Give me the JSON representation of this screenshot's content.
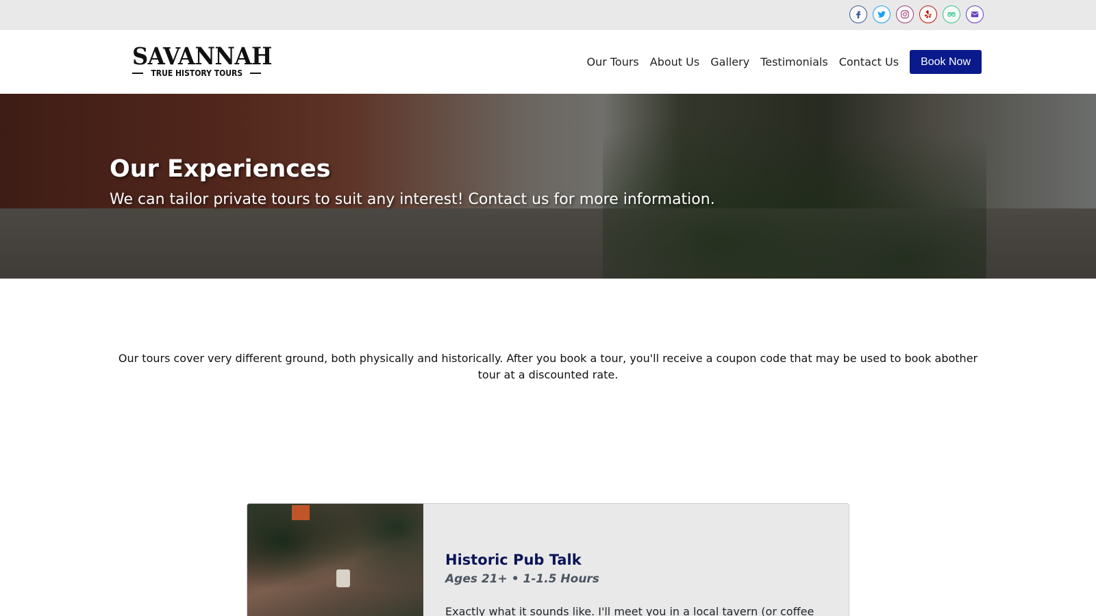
{
  "social": [
    {
      "name": "facebook-icon",
      "color": "#3b5998"
    },
    {
      "name": "twitter-icon",
      "color": "#1da1f2"
    },
    {
      "name": "instagram-icon",
      "color": "#a23f7a"
    },
    {
      "name": "yelp-icon",
      "color": "#c41200"
    },
    {
      "name": "tripadvisor-icon",
      "color": "#34c48a"
    },
    {
      "name": "email-icon",
      "color": "#6a3fc4"
    }
  ],
  "logo": {
    "main": "SAVANNAH",
    "sub": "TRUE HISTORY TOURS"
  },
  "nav": {
    "items": [
      "Our Tours",
      "About Us",
      "Gallery",
      "Testimonials",
      "Contact Us"
    ],
    "book_label": "Book Now",
    "book_color": "#0a1a8c"
  },
  "hero": {
    "title": "Our Experiences",
    "subtitle": "We can tailor private tours to suit any interest! Contact us for more information."
  },
  "intro": {
    "text": "Our tours cover very different ground, both physically and historically. After you book a tour, you'll receive a coupon code that may be used to book abother tour at a discounted rate."
  },
  "tour": {
    "title": "Historic Pub Talk",
    "meta": "Ages 21+ • 1-1.5 Hours",
    "description": "Exactly what it sounds like. I'll meet you in a local tavern (or coffee"
  }
}
